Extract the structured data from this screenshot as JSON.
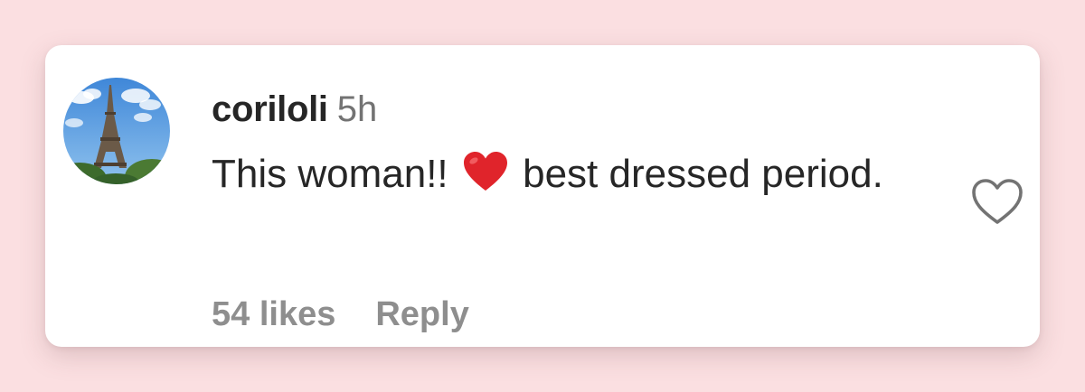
{
  "comment": {
    "username": "coriloli",
    "timestamp": "5h",
    "text_before_emoji": "This woman!!",
    "emoji": "red-heart-emoji",
    "text_after_emoji": "best dressed period.",
    "likes_label": "54 likes",
    "reply_label": "Reply",
    "like_icon": "heart-outline-icon",
    "avatar_subject": "eiffel-tower-photo"
  },
  "colors": {
    "background": "#fbdfe1",
    "card": "#ffffff",
    "text_primary": "#262626",
    "text_secondary": "#8e8e8e",
    "heart_red": "#e0242b"
  }
}
